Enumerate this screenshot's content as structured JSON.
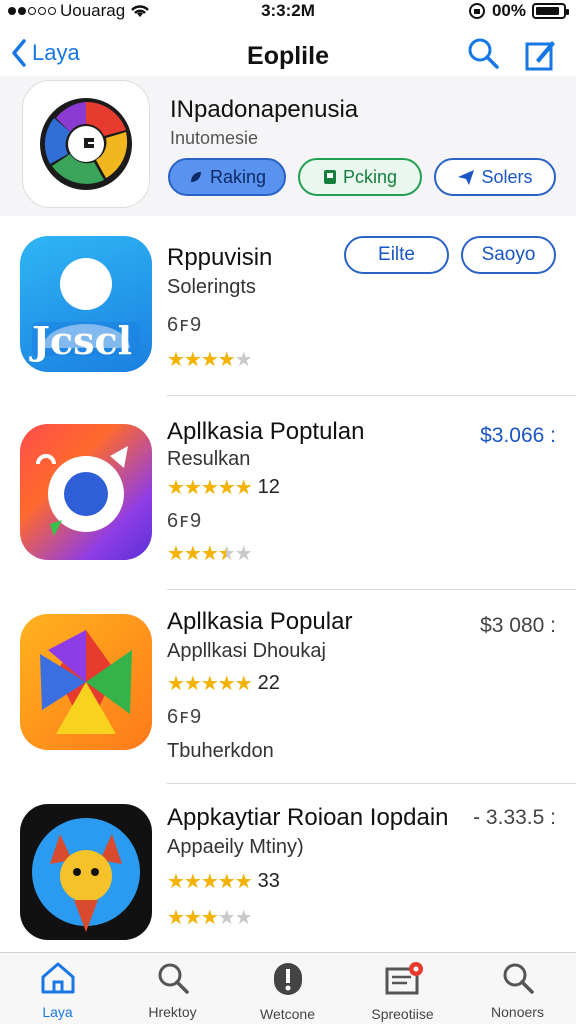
{
  "status_bar": {
    "carrier": "Uouarag",
    "time": "3:3:2M",
    "battery": "00%",
    "battery_level": 0.9
  },
  "nav": {
    "back_label": "Laya",
    "title": "Eoplile",
    "icons": [
      "search-icon",
      "compose-icon"
    ]
  },
  "header": {
    "app_name": "INpadonapenusia",
    "subtitle": "Inutomesie",
    "chips": [
      {
        "label": "Raking",
        "icon": "rocket-icon"
      },
      {
        "label": "Pcking",
        "icon": "bookmark-icon"
      },
      {
        "label": "Solers",
        "icon": "airplane-icon"
      }
    ]
  },
  "apps": [
    {
      "name": "Rppuvisin",
      "subtitle": "Soleringts",
      "glyphs": "6ꜰ9",
      "stars": 4,
      "buttons": [
        "Eilte",
        "Saoyo"
      ],
      "icon_text": "Jcscl"
    },
    {
      "name": "Apllkasia Poptulan",
      "subtitle": "Resulkan",
      "rating_count": "12",
      "glyphs": "6ꜰ9",
      "stars": 3.5,
      "price": "$3.066 :"
    },
    {
      "name": "Apllkasia Popular",
      "subtitle": "Appllkasi Dhoukaj",
      "rating_count": "22",
      "glyphs": "6ꜰ9",
      "extra": "Tbuherkdon",
      "price": "$3 080 :"
    },
    {
      "name": "Appkaytiar Roioan Iopdain",
      "subtitle": "Appaeily Mtiny)",
      "rating_count": "33",
      "stars": 3,
      "price": "- 3.33.5 :"
    }
  ],
  "tabbar": {
    "tabs": [
      {
        "label": "Laya",
        "icon": "home-icon"
      },
      {
        "label": "Hrektoy",
        "icon": "search-icon"
      },
      {
        "label": "Wetcone",
        "icon": "exclamation-icon"
      },
      {
        "label": "Spreotiise",
        "icon": "inbox-icon"
      },
      {
        "label": "Nonoers",
        "icon": "search-icon"
      }
    ]
  },
  "colors": {
    "accent": "#1877e6",
    "star": "#f5b301",
    "badge": "#e63b2e"
  }
}
